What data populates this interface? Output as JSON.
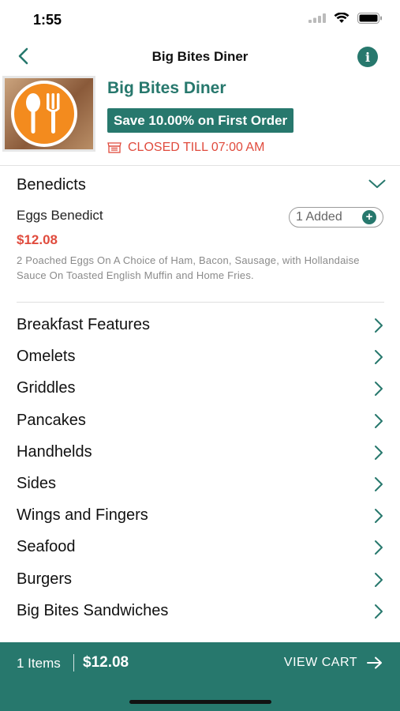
{
  "status_bar": {
    "time": "1:55"
  },
  "nav": {
    "title": "Big Bites Diner",
    "info_glyph": "i"
  },
  "restaurant": {
    "name": "Big Bites Diner",
    "promo": "Save 10.00% on First Order",
    "status": "CLOSED TILL 07:00 AM"
  },
  "section": {
    "title": "Benedicts",
    "item": {
      "name": "Eggs Benedict",
      "added_label": "1 Added",
      "add_glyph": "+",
      "price": "$12.08",
      "description": "2 Poached Eggs On A Choice of Ham, Bacon, Sausage, with Hollandaise Sauce On Toasted English Muffin and Home Fries."
    }
  },
  "categories": [
    "Breakfast Features",
    "Omelets",
    "Griddles",
    "Pancakes",
    "Handhelds",
    "Sides",
    "Wings and Fingers",
    "Seafood",
    "Burgers",
    "Big Bites Sandwiches"
  ],
  "cart": {
    "count_label": "1 Items",
    "total": "$12.08",
    "view_label": "VIEW CART"
  },
  "colors": {
    "brand": "#27786d",
    "alert": "#e04b3d"
  },
  "icons": [
    "back-chevron-icon",
    "info-icon",
    "storefront-icon",
    "chevron-down-icon",
    "chevron-right-icon",
    "arrow-right-icon",
    "plus-icon"
  ]
}
